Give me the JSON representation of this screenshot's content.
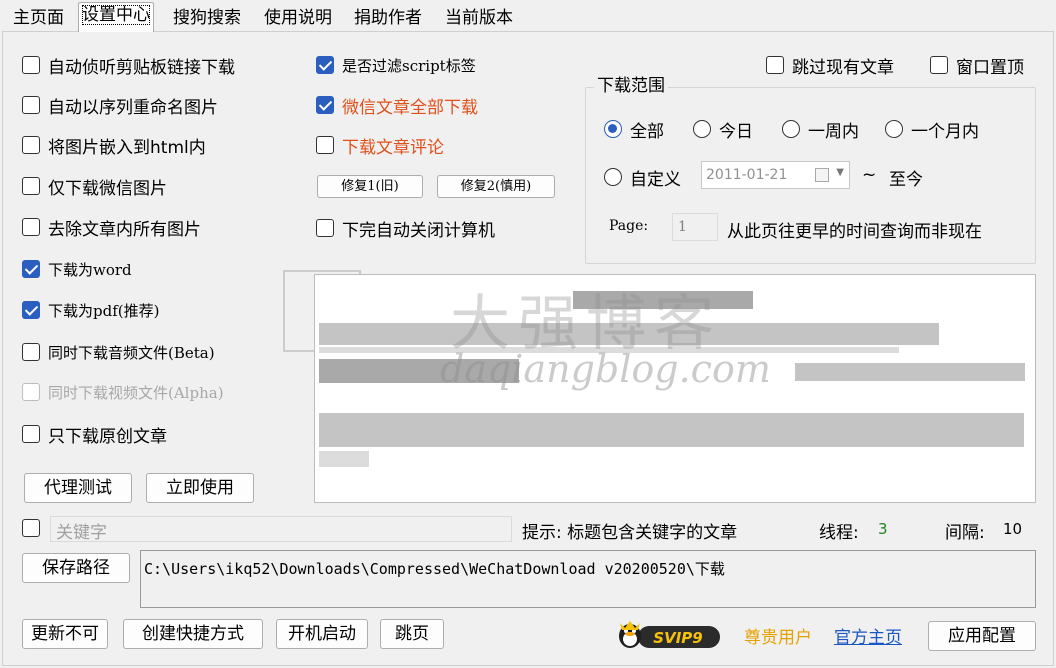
{
  "tabs": [
    "主页面",
    "设置中心",
    "搜狗搜索",
    "使用说明",
    "捐助作者",
    "当前版本"
  ],
  "active_tab": "设置中心",
  "left_options": [
    {
      "label": "自动侦听剪贴板链接下载",
      "checked": false
    },
    {
      "label": "自动以序列重命名图片",
      "checked": false
    },
    {
      "label": "将图片嵌入到html内",
      "checked": false
    },
    {
      "label": "仅下载微信图片",
      "checked": false
    },
    {
      "label": "去除文章内所有图片",
      "checked": false
    },
    {
      "label": "下载为word",
      "checked": true
    },
    {
      "label": "下载为pdf(推荐)",
      "checked": true
    },
    {
      "label": "同时下载音频文件(Beta)",
      "checked": false
    },
    {
      "label": "同时下载视频文件(Alpha)",
      "checked": false,
      "disabled": true
    },
    {
      "label": "只下载原创文章",
      "checked": false
    }
  ],
  "mid_options": [
    {
      "label": "是否过滤script标签",
      "checked": true
    },
    {
      "label": "微信文章全部下载",
      "checked": true,
      "highlight": true
    },
    {
      "label": "下载文章评论",
      "checked": false,
      "highlight": true
    },
    {
      "label": "下完自动关闭计算机",
      "checked": false
    }
  ],
  "fix_buttons": [
    "修复1(旧)",
    "修复2(慎用)"
  ],
  "top_right": [
    {
      "label": "跳过现有文章",
      "checked": false
    },
    {
      "label": "窗口置顶",
      "checked": false
    }
  ],
  "range": {
    "title": "下载范围",
    "options": [
      "全部",
      "今日",
      "一周内",
      "一个月内"
    ],
    "selected": "全部",
    "custom_label": "自定义",
    "date_value": "2011-01-21",
    "tilde": "~",
    "until_now": "至今",
    "page_label": "Page:",
    "page_value": "1",
    "page_hint": "从此页往更早的时间查询而非现在"
  },
  "watermark": {
    "cn": "大强博客",
    "en": "daqiangblog.com"
  },
  "proxy_buttons": [
    "代理测试",
    "立即使用"
  ],
  "keyword": {
    "checked": false,
    "placeholder": "关键字"
  },
  "hint": "提示: 标题包含关键字的文章",
  "threads": {
    "label": "线程:",
    "value": "3"
  },
  "interval": {
    "label": "间隔:",
    "value": "10"
  },
  "save_path_button": "保存路径",
  "save_path": "C:\\Users\\ikq52\\Downloads\\Compressed\\WeChatDownload  v20200520\\下载",
  "bottom_buttons": [
    "更新不可",
    "创建快捷方式",
    "开机启动",
    "跳页"
  ],
  "svip_badge": "SVIP9",
  "user_level": "尊贵用户",
  "official_site": "官方主页",
  "apply_button": "应用配置",
  "colors": {
    "accent": "#2a5fbf",
    "highlight": "#e0501a",
    "gold": "#e5a100",
    "link": "#1a56c4",
    "number": "#1a8a1a"
  }
}
